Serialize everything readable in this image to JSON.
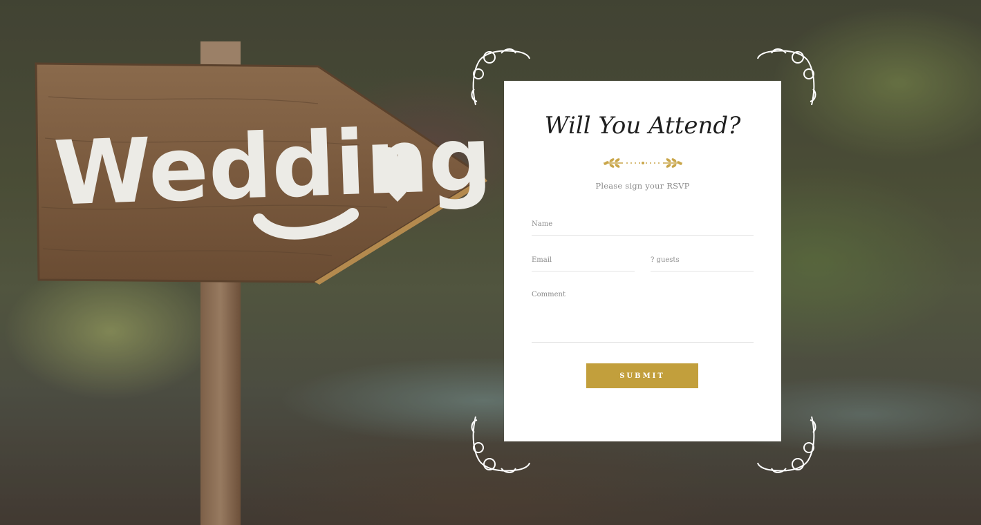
{
  "sign": {
    "text": "Wedding"
  },
  "rsvp": {
    "title": "Will You Attend?",
    "subtitle": "Please sign your RSVP",
    "name_placeholder": "Name",
    "email_placeholder": "Email",
    "guests_placeholder": "? guests",
    "comment_placeholder": "Comment",
    "submit_label": "SUBMIT"
  },
  "colors": {
    "accent_gold": "#c29f3c",
    "card_background": "#ffffff",
    "ornament": "#ffffff"
  },
  "icons": [
    "laurel-divider-icon",
    "floral-corner-icon",
    "heart-icon"
  ]
}
